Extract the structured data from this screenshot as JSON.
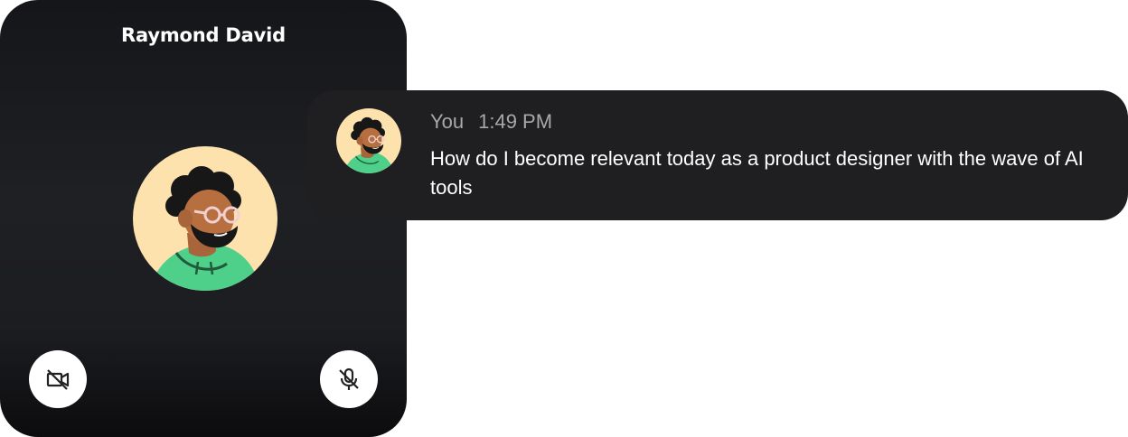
{
  "call": {
    "participant_name": "Raymond David",
    "avatar_icon": "person-avatar-icon",
    "controls": {
      "video_icon": "video-off-icon",
      "mic_icon": "mic-off-icon"
    }
  },
  "message": {
    "sender": "You",
    "time": "1:49 PM",
    "text": "How do I become relevant today as a product designer with the wave of AI tools",
    "avatar_icon": "person-avatar-icon"
  },
  "colors": {
    "avatar_bg": "#fde2ae",
    "hoodie": "#4fd08a",
    "tile_bg": "#1f2024",
    "bubble_bg": "#1f1f21"
  }
}
